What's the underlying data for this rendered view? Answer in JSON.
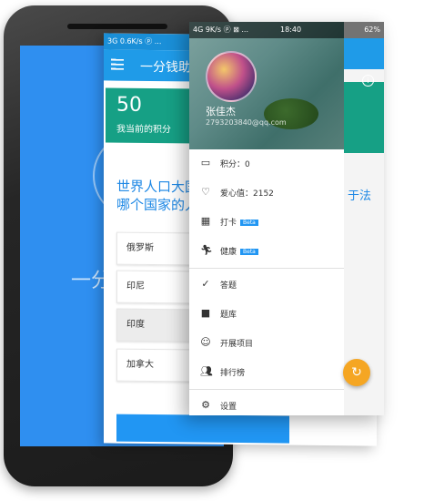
{
  "phone": {
    "screen_text": "一分"
  },
  "quiz_screen": {
    "status": "3G  0.6K/s  ⓟ  ...",
    "title": "一分钱助",
    "score": "50",
    "score_label": "我当前的积分",
    "question": "世界人口大国\n哪个国家的人",
    "options": [
      "俄罗斯",
      "印尼",
      "印度",
      "加拿大"
    ],
    "selected_index": 2
  },
  "drawer_screen": {
    "status_left": "4G 9K/s ⓟ ⊠ ...",
    "status_time": "18:40",
    "status_right": "62%",
    "user_name": "张佳杰",
    "user_email": "2793203840@qq.com",
    "info_icon": "info-icon",
    "right_text": "于法",
    "items": [
      {
        "icon": "card-icon",
        "label": "积分：0"
      },
      {
        "icon": "heart-icon",
        "label": "爱心值：2152"
      },
      {
        "icon": "calendar-icon",
        "label": "打卡",
        "badge": "Beta"
      },
      {
        "icon": "running-icon",
        "label": "健康",
        "badge": "Beta"
      },
      {
        "icon": "check-circle-icon",
        "label": "答题"
      },
      {
        "icon": "book-icon",
        "label": "题库"
      },
      {
        "icon": "smile-icon",
        "label": "开展项目"
      },
      {
        "icon": "people-icon",
        "label": "排行榜"
      },
      {
        "icon": "gear-icon",
        "label": "设置"
      }
    ]
  },
  "colors": {
    "primary": "#1f9be8",
    "teal": "#16a085",
    "accent": "#f5a623"
  }
}
